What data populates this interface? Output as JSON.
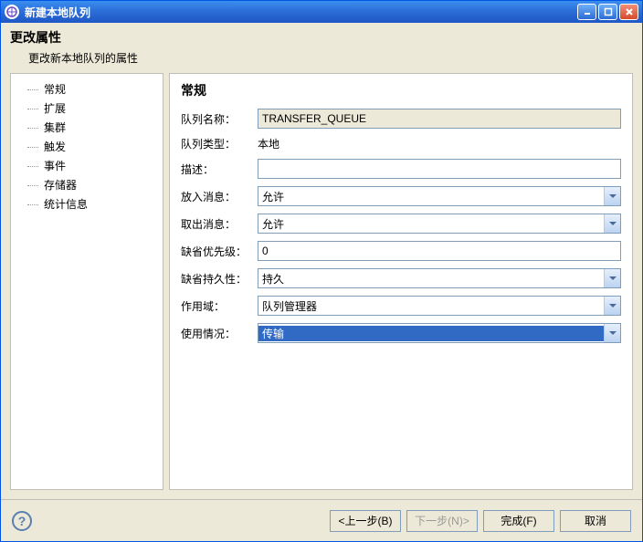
{
  "window": {
    "title": "新建本地队列"
  },
  "header": {
    "title": "更改属性",
    "subtitle": "更改新本地队列的属性"
  },
  "sidebar": {
    "items": [
      {
        "label": "常规"
      },
      {
        "label": "扩展"
      },
      {
        "label": "集群"
      },
      {
        "label": "触发"
      },
      {
        "label": "事件"
      },
      {
        "label": "存储器"
      },
      {
        "label": "统计信息"
      }
    ],
    "selected_index": 0
  },
  "section": {
    "title": "常规",
    "fields": {
      "queue_name": {
        "label": "队列名称：",
        "value": "TRANSFER_QUEUE",
        "type": "readonly"
      },
      "queue_type": {
        "label": "队列类型：",
        "value": "本地",
        "type": "static"
      },
      "description": {
        "label": "描述：",
        "value": "",
        "type": "text"
      },
      "put_messages": {
        "label": "放入消息：",
        "value": "允许",
        "type": "combo"
      },
      "get_messages": {
        "label": "取出消息：",
        "value": "允许",
        "type": "combo"
      },
      "default_priority": {
        "label": "缺省优先级：",
        "value": "0",
        "type": "text"
      },
      "default_persistence": {
        "label": "缺省持久性：",
        "value": "持久",
        "type": "combo"
      },
      "scope": {
        "label": "作用域：",
        "value": "队列管理器",
        "type": "combo"
      },
      "usage": {
        "label": "使用情况：",
        "value": "传输",
        "type": "combo",
        "selected": true
      }
    }
  },
  "footer": {
    "back": "<上一步(B)",
    "next": "下一步(N)>",
    "finish": "完成(F)",
    "cancel": "取消"
  }
}
